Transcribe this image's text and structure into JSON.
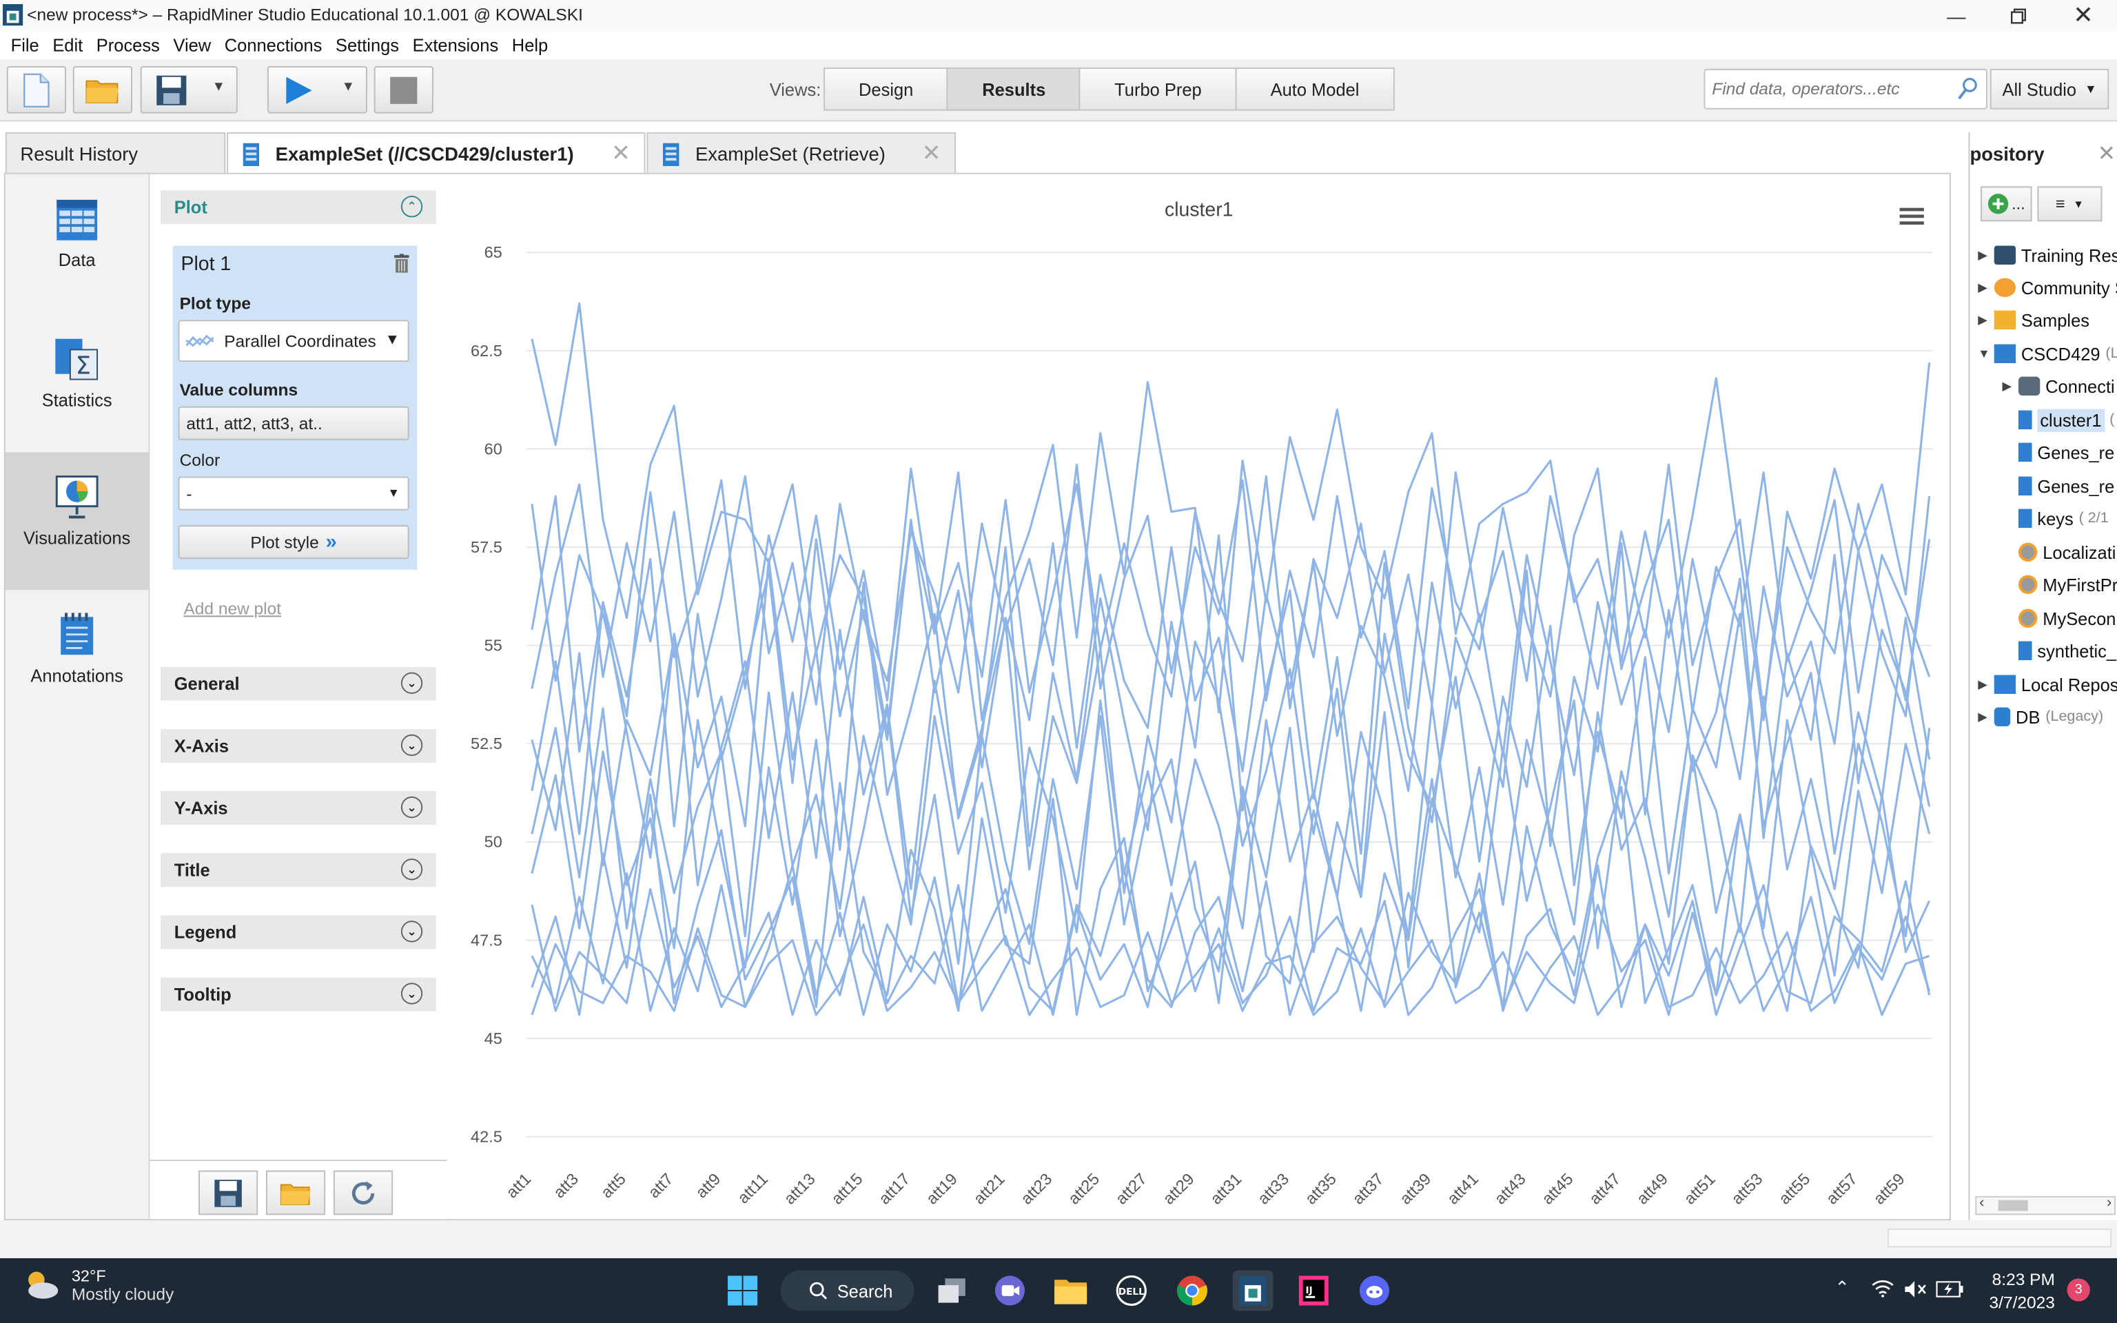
{
  "window": {
    "title": "<new process*> – RapidMiner Studio Educational 10.1.001 @ KOWALSKI"
  },
  "menu": [
    "File",
    "Edit",
    "Process",
    "View",
    "Connections",
    "Settings",
    "Extensions",
    "Help"
  ],
  "toolbar": {
    "views_label": "Views:",
    "views": [
      "Design",
      "Results",
      "Turbo Prep",
      "Auto Model"
    ],
    "active_view": "Results",
    "search_placeholder": "Find data, operators...etc",
    "studio_label": "All Studio"
  },
  "tabs": {
    "history": "Result History",
    "active": "ExampleSet (//CSCD429/cluster1)",
    "other": "ExampleSet (Retrieve)"
  },
  "leftnav": [
    "Data",
    "Statistics",
    "Visualizations",
    "Annotations"
  ],
  "config": {
    "plot_section": "Plot",
    "plot_title": "Plot 1",
    "plot_type_label": "Plot type",
    "plot_type_value": "Parallel Coordinates",
    "value_columns_label": "Value columns",
    "value_columns_value": "att1, att2, att3, at..",
    "color_label": "Color",
    "color_value": "-",
    "plot_style_label": "Plot style",
    "add_new_plot": "Add new plot",
    "sections": [
      "General",
      "X-Axis",
      "Y-Axis",
      "Title",
      "Legend",
      "Tooltip"
    ]
  },
  "repository": {
    "title": "pository",
    "add_label": "...",
    "items": [
      {
        "label": "Training Res",
        "sub": ""
      },
      {
        "label": "Community S",
        "sub": ""
      },
      {
        "label": "Samples",
        "sub": ""
      },
      {
        "label": "CSCD429",
        "sub": "(L"
      },
      {
        "label": "Connecti",
        "sub": ""
      },
      {
        "label": "cluster1",
        "sub": "("
      },
      {
        "label": "Genes_re",
        "sub": ""
      },
      {
        "label": "Genes_re",
        "sub": ""
      },
      {
        "label": "keys",
        "sub": "( 2/1"
      },
      {
        "label": "Localizati",
        "sub": ""
      },
      {
        "label": "MyFirstPr",
        "sub": ""
      },
      {
        "label": "MySecon",
        "sub": ""
      },
      {
        "label": "synthetic_",
        "sub": ""
      },
      {
        "label": "Local Repos",
        "sub": ""
      },
      {
        "label": "DB",
        "sub": "(Legacy)"
      }
    ]
  },
  "taskbar": {
    "temp": "32°F",
    "condition": "Mostly cloudy",
    "search": "Search",
    "time": "8:23 PM",
    "date": "3/7/2023",
    "notifications": "3"
  },
  "colors": {
    "line": "#8fb4e6",
    "accent": "#2b8a8a",
    "selection": "#cfe2f6"
  },
  "chart_data": {
    "type": "line",
    "subtype": "parallel-coordinates",
    "title": "cluster1",
    "ylim": [
      42.5,
      65
    ],
    "yticks": [
      42.5,
      45,
      47.5,
      50,
      52.5,
      55,
      57.5,
      60,
      62.5,
      65
    ],
    "xtick_labels": [
      "att1",
      "att3",
      "att5",
      "att7",
      "att9",
      "att11",
      "att13",
      "att15",
      "att17",
      "att19",
      "att21",
      "att23",
      "att25",
      "att27",
      "att29",
      "att31",
      "att33",
      "att35",
      "att37",
      "att39",
      "att41",
      "att43",
      "att45",
      "att47",
      "att49",
      "att51",
      "att53",
      "att55",
      "att57",
      "att59"
    ],
    "num_attributes": 60,
    "grid": true,
    "legend": "none",
    "series": [
      {
        "values": [
          62.8,
          60.1,
          63.7,
          58.2,
          55.7,
          59.6,
          61.1,
          56.3,
          58.4,
          58.2,
          57.1,
          59.1,
          54.8,
          57.3,
          56.2,
          52.8,
          58.1,
          55.3,
          59.4,
          53.1,
          56.2,
          57.9,
          60.1,
          55.2,
          60.4,
          56.8,
          61.7,
          58.4,
          58.5,
          53.3,
          59.7,
          56.1,
          60.3,
          58.2,
          61.0,
          57.5,
          56.2,
          58.9,
          60.4,
          55.3,
          58.1,
          58.6,
          58.9,
          59.7,
          56.1,
          57.2,
          54.6,
          57.9,
          55.2,
          58.3,
          61.8,
          57.3,
          53.1,
          58.4,
          56.7,
          59.5,
          57.4,
          59.1,
          56.3,
          62.2
        ]
      },
      {
        "values": [
          55.4,
          58.8,
          52.3,
          56.1,
          53.7,
          57.2,
          50.4,
          55.8,
          52.1,
          54.3,
          56.9,
          51.5,
          57.7,
          53.2,
          55.9,
          52.6,
          58.2,
          53.8,
          56.4,
          51.9,
          55.7,
          53.1,
          57.6,
          52.4,
          56.8,
          54.1,
          52.9,
          57.5,
          53.6,
          55.2,
          51.8,
          56.3,
          53.9,
          57.1,
          52.7,
          55.5,
          54.2,
          51.3,
          56.6,
          53.4,
          55.8,
          52.2,
          57.3,
          54.6,
          51.7,
          56.1,
          53.5,
          55.4,
          52.8,
          57.2,
          54.3,
          51.6,
          56.5,
          53.7,
          55.1,
          52.5,
          57.4,
          54.8,
          53.2,
          58.8
        ]
      },
      {
        "values": [
          49.2,
          51.7,
          47.8,
          52.3,
          48.9,
          50.6,
          47.3,
          53.1,
          49.7,
          46.8,
          51.9,
          48.4,
          52.6,
          47.6,
          50.3,
          53.4,
          48.1,
          51.2,
          46.9,
          52.7,
          49.5,
          47.4,
          51.6,
          48.8,
          53.2,
          47.9,
          50.8,
          52.1,
          48.3,
          46.7,
          51.4,
          49.1,
          52.9,
          47.2,
          50.5,
          48.6,
          53.3,
          46.8,
          51.1,
          49.4,
          47.7,
          52.4,
          48.5,
          50.9,
          53.6,
          47.3,
          51.8,
          49.6,
          46.9,
          52.2,
          48.2,
          50.7,
          47.8,
          53.1,
          49.8,
          46.6,
          51.3,
          48.7,
          52.5,
          50.2
        ]
      },
      {
        "values": [
          47.1,
          45.9,
          48.6,
          46.4,
          49.2,
          45.7,
          47.8,
          46.2,
          48.9,
          45.8,
          47.3,
          49.4,
          46.1,
          48.2,
          45.6,
          47.9,
          46.7,
          49.1,
          45.9,
          47.5,
          48.8,
          46.3,
          45.7,
          48.4,
          47.1,
          49.3,
          46.5,
          45.8,
          47.7,
          48.6,
          46.2,
          49.0,
          45.6,
          47.4,
          48.1,
          46.8,
          45.9,
          48.7,
          47.2,
          46.4,
          49.2,
          45.7,
          47.6,
          48.3,
          46.1,
          49.4,
          45.8,
          47.9,
          46.6,
          48.5,
          45.6,
          47.3,
          48.9,
          46.2,
          45.9,
          48.1,
          47.5,
          46.7,
          49.0,
          46.1
        ]
      },
      {
        "values": [
          53.9,
          56.8,
          59.1,
          54.2,
          57.6,
          55.1,
          58.4,
          53.7,
          56.2,
          59.3,
          54.8,
          57.1,
          53.5,
          58.6,
          55.7,
          54.1,
          57.9,
          56.3,
          53.8,
          58.1,
          55.4,
          57.2,
          54.5,
          59.6,
          53.9,
          56.7,
          58.3,
          54.3,
          57.5,
          55.8,
          59.2,
          53.6,
          56.9,
          54.7,
          58.8,
          55.2,
          57.4,
          53.4,
          59.0,
          56.1,
          54.9,
          58.5,
          55.6,
          53.7,
          57.8,
          59.5,
          54.4,
          56.5,
          58.2,
          53.3,
          57.0,
          55.5,
          59.4,
          54.6,
          56.4,
          58.7,
          53.8,
          57.3,
          55.9,
          54.2
        ]
      },
      {
        "values": [
          46.3,
          48.1,
          45.6,
          49.7,
          46.8,
          51.2,
          45.9,
          48.4,
          50.3,
          46.5,
          47.7,
          49.1,
          45.8,
          51.5,
          47.2,
          46.1,
          49.8,
          48.3,
          45.7,
          50.6,
          47.4,
          46.9,
          51.1,
          45.6,
          48.8,
          50.1,
          46.2,
          47.8,
          49.5,
          45.9,
          51.3,
          47.1,
          46.4,
          50.8,
          48.6,
          45.7,
          49.2,
          47.5,
          51.6,
          46.3,
          48.2,
          45.8,
          50.4,
          47.9,
          46.6,
          49.6,
          51.4,
          45.9,
          47.3,
          48.9,
          46.1,
          50.7,
          47.6,
          45.7,
          49.9,
          48.4,
          46.8,
          51.2,
          47.2,
          48.5
        ]
      },
      {
        "values": [
          51.3,
          54.6,
          50.2,
          56.1,
          52.8,
          49.6,
          55.3,
          51.9,
          53.7,
          50.4,
          57.2,
          52.1,
          54.9,
          49.8,
          56.6,
          51.2,
          53.4,
          55.8,
          50.6,
          52.7,
          57.5,
          49.9,
          54.3,
          51.6,
          56.2,
          53.1,
          50.3,
          55.6,
          52.4,
          57.8,
          50.8,
          53.9,
          56.4,
          51.1,
          54.7,
          49.7,
          57.1,
          52.9,
          50.5,
          55.2,
          53.6,
          51.4,
          56.9,
          49.9,
          54.2,
          52.3,
          57.6,
          50.7,
          55.9,
          51.8,
          53.3,
          56.7,
          50.1,
          54.8,
          52.6,
          57.3,
          51.5,
          55.4,
          53.8,
          50.9
        ]
      },
      {
        "values": [
          48.4,
          45.7,
          47.2,
          46.6,
          45.9,
          48.8,
          46.3,
          47.6,
          45.8,
          46.9,
          48.2,
          45.6,
          47.5,
          46.1,
          48.6,
          45.9,
          47.1,
          46.4,
          48.9,
          45.7,
          46.8,
          47.9,
          45.6,
          48.3,
          46.5,
          47.4,
          45.8,
          48.7,
          46.2,
          47.8,
          45.9,
          46.6,
          48.1,
          45.7,
          47.3,
          46.9,
          48.5,
          45.6,
          46.3,
          47.7,
          48.8,
          45.8,
          47.2,
          46.4,
          45.9,
          48.4,
          46.7,
          47.5,
          45.6,
          48.2,
          46.1,
          47.9,
          45.7,
          46.8,
          48.6,
          45.9,
          47.3,
          46.5,
          48.1,
          46.2
        ]
      },
      {
        "values": [
          50.2,
          52.9,
          49.1,
          53.4,
          47.8,
          51.6,
          48.7,
          50.9,
          52.3,
          47.6,
          53.8,
          49.4,
          51.2,
          48.3,
          52.7,
          50.1,
          47.9,
          53.2,
          49.7,
          51.5,
          48.2,
          52.4,
          50.6,
          47.7,
          53.6,
          49.2,
          51.8,
          48.9,
          52.1,
          50.4,
          47.8,
          53.1,
          49.5,
          51.3,
          48.6,
          52.8,
          50.7,
          47.6,
          53.5,
          49.1,
          51.9,
          48.4,
          52.6,
          50.3,
          47.9,
          53.3,
          49.8,
          51.1,
          48.1,
          52.2,
          50.8,
          47.7,
          53.7,
          49.3,
          51.6,
          48.8,
          52.5,
          50.5,
          47.6,
          52.9
        ]
      },
      {
        "values": [
          58.6,
          54.1,
          57.3,
          55.8,
          53.2,
          58.9,
          54.7,
          56.5,
          59.2,
          53.9,
          57.8,
          55.1,
          58.3,
          54.4,
          56.9,
          53.6,
          59.5,
          55.4,
          57.1,
          54.2,
          58.7,
          53.8,
          56.3,
          59.1,
          54.9,
          57.6,
          55.3,
          53.7,
          58.4,
          56.1,
          54.6,
          59.3,
          53.4,
          57.2,
          55.7,
          58.1,
          54.3,
          56.8,
          53.5,
          59.4,
          55.6,
          57.4,
          54.1,
          58.8,
          56.4,
          53.9,
          57.9,
          55.2,
          59.6,
          54.5,
          56.7,
          58.2,
          53.3,
          57.5,
          55.9,
          54.8,
          58.6,
          56.2,
          53.6,
          57.7
        ]
      },
      {
        "values": [
          45.6,
          47.4,
          46.2,
          45.9,
          47.1,
          46.7,
          45.7,
          47.8,
          46.1,
          45.8,
          46.9,
          47.5,
          45.6,
          46.4,
          47.9,
          45.7,
          46.3,
          47.2,
          45.9,
          46.8,
          47.6,
          45.6,
          46.5,
          47.3,
          45.8,
          46.1,
          47.7,
          45.9,
          46.6,
          47.4,
          45.7,
          46.9,
          47.1,
          45.6,
          46.2,
          47.8,
          45.8,
          46.7,
          47.5,
          45.9,
          46.3,
          47.2,
          45.7,
          46.8,
          47.6,
          45.6,
          46.4,
          47.9,
          45.8,
          46.1,
          47.3,
          45.9,
          46.6,
          47.7,
          45.7,
          46.2,
          47.4,
          45.6,
          46.9,
          47.1
        ]
      },
      {
        "values": [
          52.6,
          50.3,
          54.8,
          49.4,
          53.1,
          51.7,
          55.2,
          48.9,
          52.4,
          54.6,
          50.1,
          53.8,
          49.6,
          55.4,
          51.2,
          53.5,
          48.8,
          54.1,
          50.7,
          52.9,
          55.6,
          49.3,
          53.2,
          51.5,
          54.9,
          48.7,
          52.7,
          50.5,
          55.1,
          53.6,
          49.9,
          51.8,
          54.4,
          50.2,
          53.9,
          48.6,
          55.3,
          52.2,
          50.9,
          54.2,
          49.5,
          53.7,
          51.4,
          55.5,
          48.9,
          52.8,
          50.6,
          54.7,
          49.2,
          53.4,
          51.9,
          55.8,
          50.4,
          52.5,
          54.3,
          49.7,
          53.3,
          51.1,
          55.7,
          52.1
        ]
      }
    ]
  }
}
